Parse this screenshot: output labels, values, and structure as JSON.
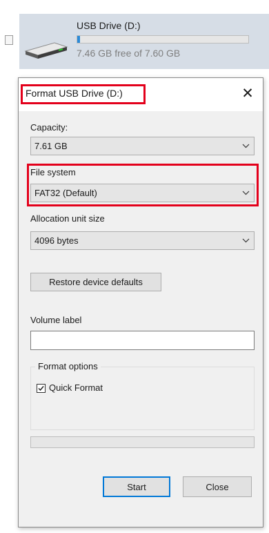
{
  "explorer": {
    "drive": {
      "name": "USB Drive (D:)",
      "free_text": "7.46 GB free of 7.60 GB",
      "used_fraction": 0.018,
      "icon": "usb-drive-icon",
      "bar_color": "#2a8ad8"
    }
  },
  "dialog": {
    "title": "Format USB Drive (D:)",
    "close_icon": "close-icon",
    "highlight_color": "#e3001b",
    "capacity": {
      "label": "Capacity:",
      "value": "7.61 GB"
    },
    "file_system": {
      "label": "File system",
      "value": "FAT32 (Default)"
    },
    "allocation": {
      "label": "Allocation unit size",
      "value": "4096 bytes"
    },
    "restore_button": "Restore device defaults",
    "volume": {
      "label": "Volume label",
      "value": ""
    },
    "format_options": {
      "label": "Format options",
      "quick_format": {
        "label": "Quick Format",
        "checked": true
      }
    },
    "progress_fraction": 0,
    "start_button": "Start",
    "close_button": "Close"
  }
}
